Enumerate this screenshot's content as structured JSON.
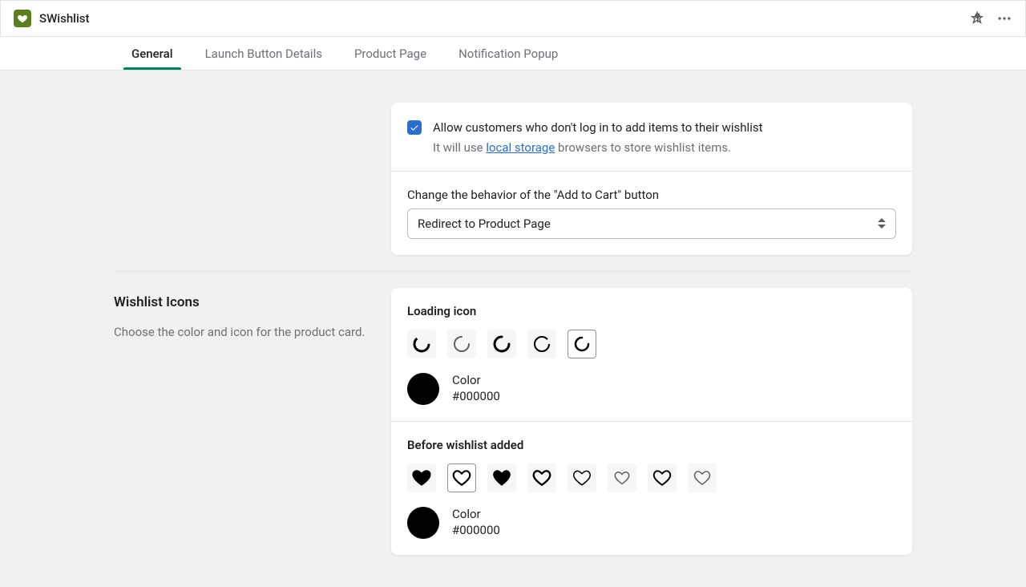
{
  "header": {
    "title": "SWishlist"
  },
  "tabs": [
    {
      "label": "General",
      "active": true
    },
    {
      "label": "Launch Button Details",
      "active": false
    },
    {
      "label": "Product Page",
      "active": false
    },
    {
      "label": "Notification Popup",
      "active": false
    }
  ],
  "behavior": {
    "checkbox_label": "Allow customers who don't log in to add items to their wishlist",
    "help_prefix": "It will use ",
    "help_link": "local storage",
    "help_suffix": " browsers to store wishlist items.",
    "atc_label": "Change the behavior of the \"Add to Cart\" button",
    "atc_selected": "Redirect to Product Page"
  },
  "icons": {
    "section_title": "Wishlist Icons",
    "section_desc": "Choose the color and icon for the product card.",
    "loading": {
      "heading": "Loading icon",
      "color_label": "Color",
      "color_value": "#000000",
      "selected_index": 4
    },
    "before": {
      "heading": "Before wishlist added",
      "color_label": "Color",
      "color_value": "#000000",
      "selected_index": 1
    }
  }
}
